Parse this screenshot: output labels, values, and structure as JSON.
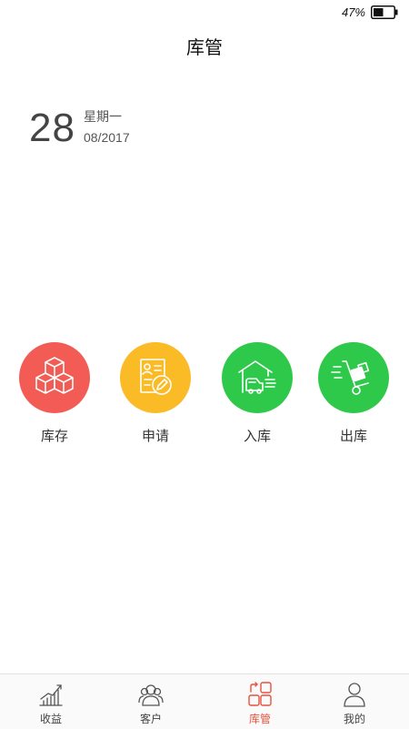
{
  "status_bar": {
    "battery_percent_text": "47%",
    "battery_level": 0.47
  },
  "header": {
    "title": "库管"
  },
  "date": {
    "day": "28",
    "weekday": "星期一",
    "month_year": "08/2017"
  },
  "actions": [
    {
      "label": "库存",
      "icon": "boxes-icon",
      "color": "#f25c54"
    },
    {
      "label": "申请",
      "icon": "form-edit-icon",
      "color": "#fbbb27"
    },
    {
      "label": "入库",
      "icon": "warehouse-truck-icon",
      "color": "#2ec84a"
    },
    {
      "label": "出库",
      "icon": "hand-truck-icon",
      "color": "#2ec84a"
    }
  ],
  "tabs": [
    {
      "label": "收益",
      "icon": "chart-trend-icon",
      "active": false
    },
    {
      "label": "客户",
      "icon": "users-icon",
      "active": false
    },
    {
      "label": "库管",
      "icon": "grid-swap-icon",
      "active": true
    },
    {
      "label": "我的",
      "icon": "user-icon",
      "active": false
    }
  ],
  "colors": {
    "accent": "#e8513d",
    "tab_inactive": "#444444"
  }
}
